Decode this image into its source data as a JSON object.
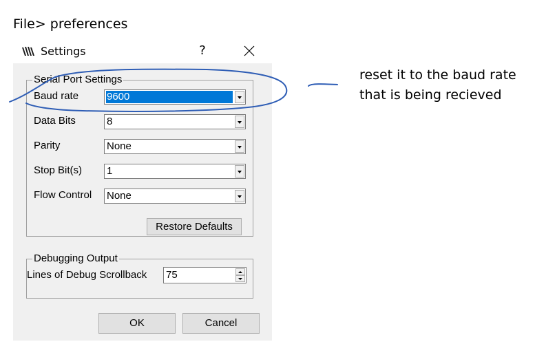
{
  "caption": "File> preferences",
  "dialog": {
    "title": "Settings",
    "help_glyph": "?",
    "close_icon": "close-icon",
    "app_icon": "app-logo-icon"
  },
  "serial_port": {
    "legend": "Serial Port Settings",
    "fields": [
      {
        "label": "Baud rate",
        "value": "9600",
        "selected": true
      },
      {
        "label": "Data Bits",
        "value": "8",
        "selected": false
      },
      {
        "label": "Parity",
        "value": "None",
        "selected": false
      },
      {
        "label": "Stop Bit(s)",
        "value": "1",
        "selected": false
      },
      {
        "label": "Flow Control",
        "value": "None",
        "selected": false
      }
    ],
    "restore_label": "Restore Defaults"
  },
  "debug": {
    "legend": "Debugging Output",
    "label": "Lines of Debug Scrollback",
    "value": "75"
  },
  "footer": {
    "ok_label": "OK",
    "cancel_label": "Cancel"
  },
  "annotation": {
    "line1": "reset it to the baud rate",
    "line2": "that is being recieved",
    "ink_color": "#2e5db5"
  },
  "colors": {
    "selection": "#0078d7",
    "dialog_bg": "#f0f0f0"
  }
}
